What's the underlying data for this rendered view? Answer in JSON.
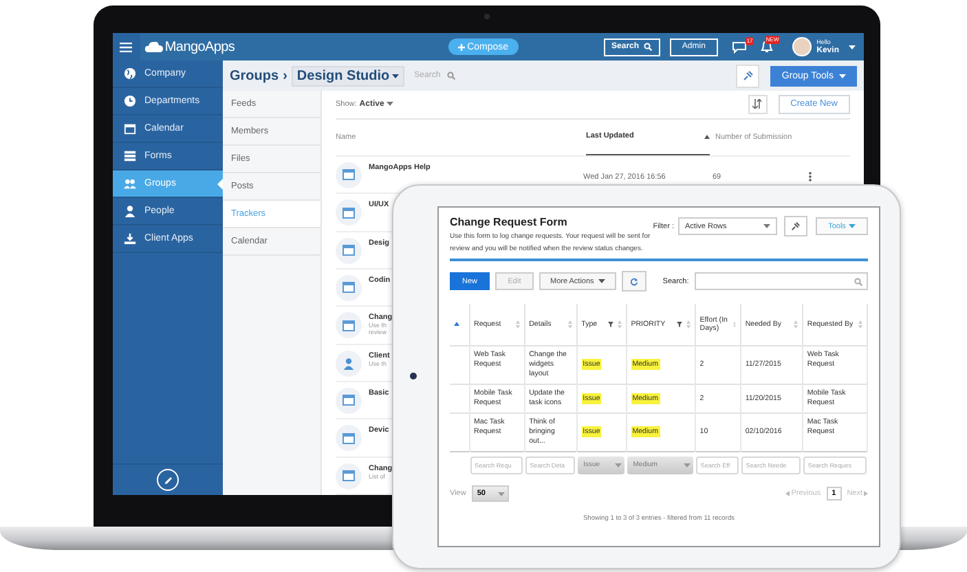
{
  "topbar": {
    "app_name": "MangoApps",
    "compose": "Compose",
    "search": "Search",
    "admin": "Admin",
    "chat_badge": "17",
    "bell_badge": "NEW",
    "greeting": "Hello",
    "user": "Kevin"
  },
  "sidebar": {
    "items": [
      {
        "label": "Company",
        "kind": "globe",
        "selected": false
      },
      {
        "label": "Departments",
        "kind": "clock",
        "selected": false
      },
      {
        "label": "Calendar",
        "kind": "calendar",
        "selected": false
      },
      {
        "label": "Forms",
        "kind": "list",
        "selected": false
      },
      {
        "label": "Groups",
        "kind": "people",
        "selected": true
      },
      {
        "label": "People",
        "kind": "person",
        "selected": false
      },
      {
        "label": "Client Apps",
        "kind": "download",
        "selected": false
      }
    ]
  },
  "header": {
    "crumb": "Groups",
    "separator": "›",
    "group": "Design Studio",
    "search_placeholder": "Search",
    "group_tools": "Group Tools"
  },
  "subnav": {
    "items": [
      {
        "label": "Feeds",
        "selected": false
      },
      {
        "label": "Members",
        "selected": false
      },
      {
        "label": "Files",
        "selected": false
      },
      {
        "label": "Posts",
        "selected": false
      },
      {
        "label": "Trackers",
        "selected": true
      },
      {
        "label": "Calendar",
        "selected": false
      }
    ]
  },
  "list": {
    "show_label": "Show:",
    "show_value": "Active",
    "create": "Create New",
    "columns": [
      "Name",
      "Last Updated",
      "Number of Submission"
    ],
    "rows": [
      {
        "kind": "form",
        "name": "MangoApps Help",
        "updated": "Wed Jan 27, 2016 16:56",
        "count": "69"
      },
      {
        "kind": "form",
        "name": "UI/UX"
      },
      {
        "kind": "form",
        "name": "Desig"
      },
      {
        "kind": "form",
        "name": "Codin"
      },
      {
        "kind": "form",
        "name": "Chang",
        "description": [
          "Use th",
          "review"
        ]
      },
      {
        "kind": "person",
        "name": "Client",
        "description": [
          "Use th"
        ]
      },
      {
        "kind": "form",
        "name": "Basic"
      },
      {
        "kind": "form",
        "name": "Devic"
      },
      {
        "kind": "form",
        "name": "Chang",
        "description": [
          "List of"
        ]
      }
    ]
  },
  "tracker": {
    "title": "Change Request Form",
    "description": "Use this form to log change requests. Your request will be sent for review and you will be notified when the review status changes.",
    "filter_label": "Filter :",
    "filter_value": "Active Rows",
    "tools": "Tools",
    "actions": [
      {
        "label": "New",
        "kind": "primary",
        "disabled": false
      },
      {
        "label": "Edit",
        "kind": "plain",
        "disabled": true
      },
      {
        "label": "More Actions",
        "kind": "menu",
        "disabled": false
      }
    ],
    "search_label": "Search:",
    "columns": [
      {
        "label": "Request",
        "kind": "sort"
      },
      {
        "label": "Details",
        "kind": "sort"
      },
      {
        "label": "Type",
        "kind": "filter"
      },
      {
        "label": "PRIORITY",
        "kind": "filter"
      },
      {
        "label": "Effort (In Days)",
        "kind": "sort"
      },
      {
        "label": "Needed By",
        "kind": "sort"
      },
      {
        "label": "Requested By",
        "kind": "sort"
      }
    ],
    "rows": [
      {
        "request": "Web Task Request",
        "details": "Change the widgets layout",
        "type": "Issue",
        "priority": "Medium",
        "effort": "2",
        "needed_by": "11/27/2015",
        "requested_by": "Web Task Request"
      },
      {
        "request": "Mobile Task Request",
        "details": "Update the task icons",
        "type": "Issue",
        "priority": "Medium",
        "effort": "2",
        "needed_by": "11/20/2015",
        "requested_by": "Mobile Task Request"
      },
      {
        "request": "Mac Task Request",
        "details": "Think of bringing out...",
        "type": "Issue",
        "priority": "Medium",
        "effort": "10",
        "needed_by": "02/10/2016",
        "requested_by": "Mac Task Request"
      }
    ],
    "footer_filters": [
      {
        "kind": "text",
        "text": "Search Requ"
      },
      {
        "kind": "text",
        "text": "Search Deta"
      },
      {
        "kind": "select",
        "text": "Issue"
      },
      {
        "kind": "select",
        "text": "Medium"
      },
      {
        "kind": "text",
        "text": "Search Eff"
      },
      {
        "kind": "text",
        "text": "Search Neede"
      },
      {
        "kind": "text",
        "text": "Search Reques"
      }
    ],
    "view_label": "View",
    "view_value": "50",
    "pagination": {
      "previous": "Previous",
      "previous_disabled": true,
      "page": "1",
      "next": "Next",
      "next_disabled": true
    },
    "info": "Showing 1 to 3 of 3 entries - filtered from 11 records"
  }
}
